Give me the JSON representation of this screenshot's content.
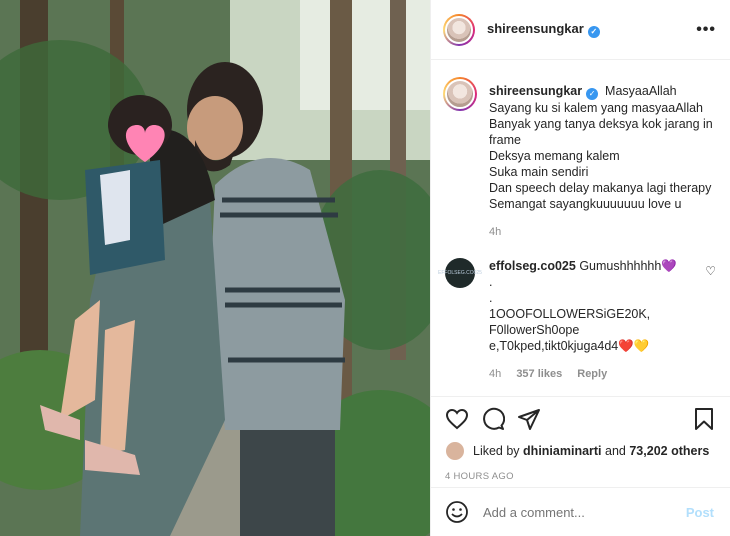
{
  "post": {
    "username": "shireensungkar",
    "more_label": "•••"
  },
  "caption": {
    "username": "shireensungkar",
    "lines": [
      "MasyaaAllah",
      "Sayang ku si kalem yang masyaaAllah",
      "Banyak yang tanya deksya kok jarang in frame",
      "Deksya memang kalem",
      "Suka main sendiri",
      "Dan speech delay makanya lagi therapy",
      "Semangat sayangkuuuuuuu love u"
    ],
    "time": "4h"
  },
  "comment": {
    "username": "effolseg.co025",
    "avatar_text": "EFFOLSEG.CO025",
    "first": "Gumushhhhhh💜",
    "lines": [
      ".",
      ".",
      "1OOOFOLLOWERSiGE20K,",
      "F0llowerSh0ope",
      "e,T0kped,tikt0kjuga4d4❤️💛"
    ],
    "time": "4h",
    "likes": "357 likes",
    "reply": "Reply"
  },
  "likes": {
    "prefix": "Liked by",
    "user": "dhiniaminarti",
    "and": "and",
    "others": "73,202 others"
  },
  "timestamp": "4 HOURS AGO",
  "add_comment": {
    "placeholder": "Add a comment...",
    "post_label": "Post"
  }
}
